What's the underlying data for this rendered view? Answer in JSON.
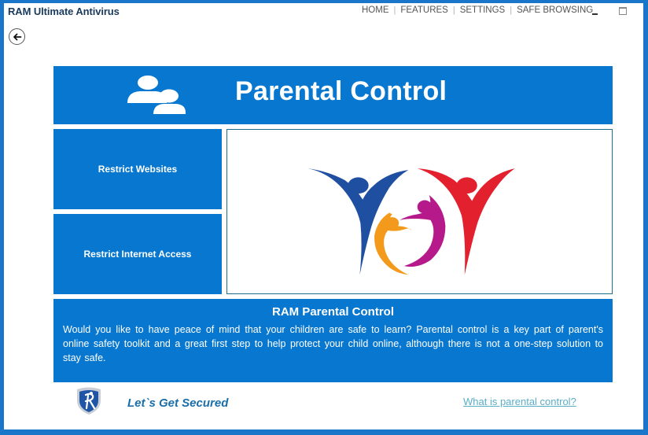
{
  "app": {
    "title": "RAM Ultimate Antivirus"
  },
  "nav": {
    "items": [
      "HOME",
      "FEATURES",
      "SETTINGS",
      "SAFE BROWSING"
    ],
    "separator": "|"
  },
  "window_controls": {
    "minimize": "minimize-icon",
    "maximize": "maximize-icon"
  },
  "back_button": {
    "icon": "arrow-left-icon"
  },
  "header": {
    "icon": "parents-icon",
    "title": "Parental Control"
  },
  "side_buttons": [
    {
      "label": "Restrict Websites"
    },
    {
      "label": "Restrict Internet Access"
    }
  ],
  "image_panel": {
    "icon": "family-logo",
    "colors": {
      "blue_figure": "#1f4fa0",
      "red_figure": "#e2202e",
      "orange_figure": "#f39a1c",
      "magenta_figure": "#b5198a"
    }
  },
  "description": {
    "title": "RAM Parental Control",
    "text": "Would you like to have peace of mind that your children are safe to learn? Parental control is a key part of  parent's online safety toolkit and a great first step to help protect your child online, although there is not a one-step solution to stay safe."
  },
  "footer": {
    "logo_icon": "shield-icon",
    "tagline": "Let`s Get Secured",
    "help_link": "What is parental control?"
  },
  "colors": {
    "accent": "#0877cf",
    "window_border": "#1a76c8",
    "tagline": "#1a6fa8",
    "link": "#5aaec6"
  }
}
